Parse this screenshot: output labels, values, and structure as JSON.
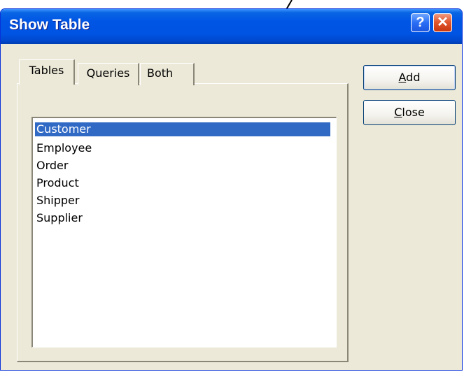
{
  "window": {
    "title": "Show Table",
    "help_glyph": "?",
    "close_glyph": "✕"
  },
  "tabs": [
    {
      "label": "Tables",
      "active": true
    },
    {
      "label": "Queries",
      "active": false
    },
    {
      "label": "Both",
      "active": false
    }
  ],
  "list": {
    "items": [
      "Customer",
      "Employee",
      "Order",
      "Product",
      "Shipper",
      "Supplier"
    ],
    "selected_index": 0
  },
  "buttons": {
    "add": {
      "mnemonic": "A",
      "rest": "dd"
    },
    "close": {
      "mnemonic": "C",
      "rest": "lose"
    }
  },
  "colors": {
    "title_bar": "#0054E3",
    "dialog_face": "#ECE9D8",
    "selection": "#316AC5",
    "close_button": "#E2572F",
    "annotation_arrow": "#000000"
  }
}
